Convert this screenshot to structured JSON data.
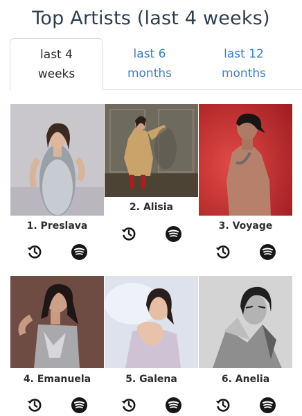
{
  "page": {
    "title": "Top Artists (last 4 weeks)"
  },
  "tabs": [
    {
      "label": "last 4\nweeks",
      "active": true
    },
    {
      "label": "last 6\nmonths",
      "active": false
    },
    {
      "label": "last 12\nmonths",
      "active": false
    }
  ],
  "artists": [
    {
      "rank_name": "1. Preslava"
    },
    {
      "rank_name": "2. Alisia"
    },
    {
      "rank_name": "3. Voyage"
    },
    {
      "rank_name": "4. Emanuela"
    },
    {
      "rank_name": "5. Galena"
    },
    {
      "rank_name": "6. Anelia"
    }
  ],
  "icons": {
    "history": "history-icon",
    "spotify": "spotify-icon"
  },
  "colors": {
    "title": "#2d3e4f",
    "tab_link": "#3c7fc0",
    "icon": "#161616"
  }
}
